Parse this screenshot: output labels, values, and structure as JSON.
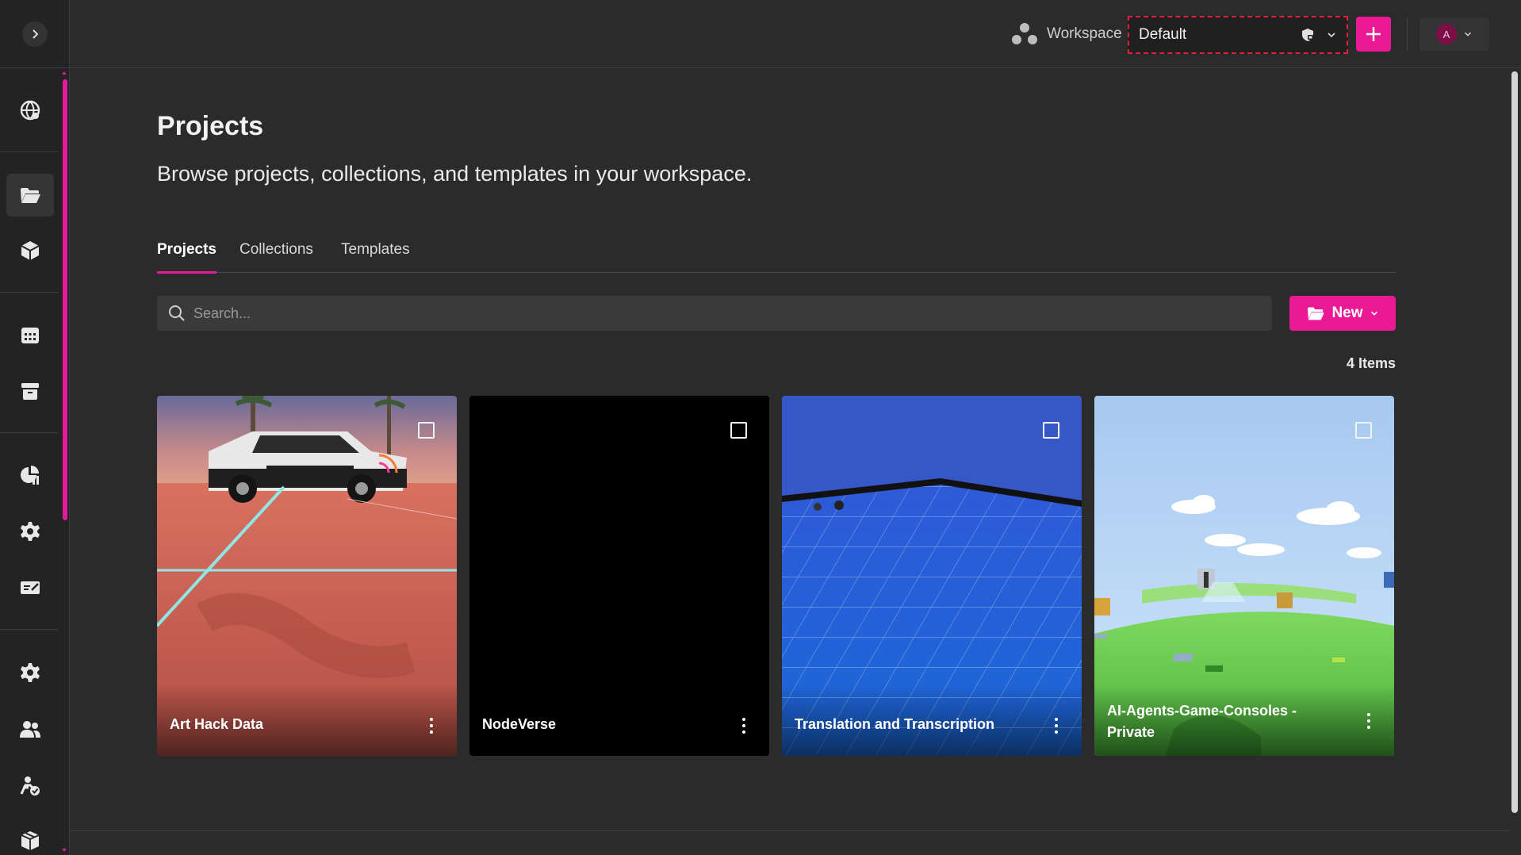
{
  "header": {
    "workspace_label": "Workspace",
    "workspace_value": "Default",
    "avatar_initial": "A"
  },
  "page": {
    "title": "Projects",
    "subtitle": "Browse projects, collections, and templates in your workspace."
  },
  "tabs": [
    {
      "label": "Projects",
      "active": true
    },
    {
      "label": "Collections",
      "active": false
    },
    {
      "label": "Templates",
      "active": false
    }
  ],
  "search": {
    "placeholder": "Search..."
  },
  "new_button": {
    "label": "New"
  },
  "item_count": "4 Items",
  "cards": [
    {
      "title": "Art Hack Data",
      "thumb": "car-street-scene"
    },
    {
      "title": "NodeVerse",
      "thumb": "black"
    },
    {
      "title": "Translation and Transcription",
      "thumb": "blue-grid"
    },
    {
      "title": "AI-Agents-Game-Consoles - Private",
      "thumb": "green-island"
    }
  ],
  "sidebar": {
    "items": [
      {
        "icon": "globe-network-icon"
      },
      {
        "icon": "folder-open-icon",
        "active": true
      },
      {
        "icon": "cube-icon"
      },
      {
        "icon": "calendar-icon"
      },
      {
        "icon": "archive-icon"
      },
      {
        "icon": "chart-pie-icon"
      },
      {
        "icon": "gear-icon"
      },
      {
        "icon": "credentials-icon"
      },
      {
        "icon": "settings-icon"
      },
      {
        "icon": "users-icon"
      },
      {
        "icon": "user-check-icon"
      },
      {
        "icon": "package-icon"
      }
    ]
  },
  "colors": {
    "accent": "#ea1a96",
    "background": "#2b2b2b",
    "sidebar": "#232323",
    "highlight_border": "#e0203a"
  }
}
